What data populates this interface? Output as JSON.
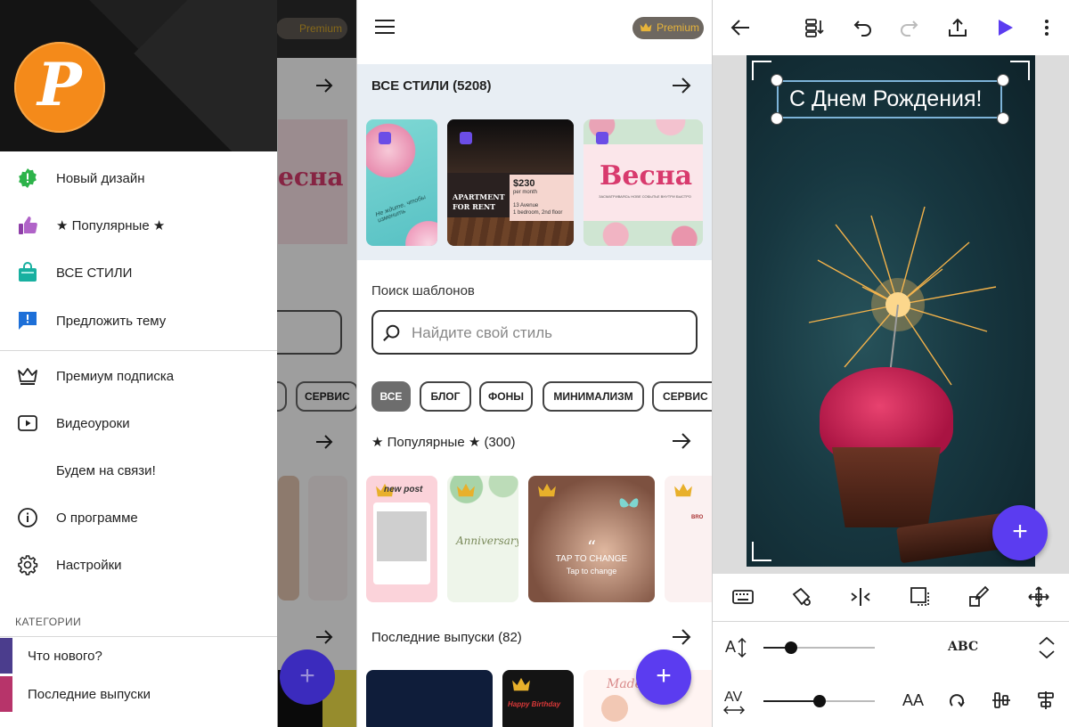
{
  "drawer": {
    "logo_letter": "P",
    "menu_items": [
      {
        "label": "Новый дизайн",
        "icon": "new-design-badge-icon"
      },
      {
        "label": "★ Популярные ★",
        "icon": "thumbs-up-icon"
      },
      {
        "label": "ВСЕ СТИЛИ",
        "icon": "shopping-bag-icon"
      },
      {
        "label": "Предложить тему",
        "icon": "feedback-icon"
      },
      {
        "label": "Премиум подписка",
        "icon": "crown-icon"
      },
      {
        "label": "Видеоуроки",
        "icon": "video-play-icon"
      },
      {
        "label": "Будем на связи!",
        "icon": ""
      },
      {
        "label": "О программе",
        "icon": "info-icon"
      },
      {
        "label": "Настройки",
        "icon": "gear-icon"
      }
    ],
    "categories_header": "КАТЕГОРИИ",
    "categories": [
      {
        "label": "Что нового?"
      },
      {
        "label": "Последние выпуски"
      }
    ]
  },
  "background_screen": {
    "premium_label": "Premium",
    "card_word": "есна",
    "chip_label": "СЕРВИС"
  },
  "main": {
    "premium_label": "Premium",
    "all_styles_title": "ВСЕ СТИЛИ (5208)",
    "template_cards": [
      {
        "text": "Не ждите, чтобы изменить"
      },
      {
        "title": "APARTMENT FOR RENT",
        "price": "$230",
        "period": "per month",
        "address": "13 Avenue",
        "rooms": "1 bedroom, 2nd floor"
      },
      {
        "title": "Весна",
        "subtitle": "ЗАСМАТРИВАЯСЬ НОВЕ СОБЫТЬЕ ВНУТРИ БЫСТРО"
      }
    ],
    "search_label": "Поиск шаблонов",
    "search_placeholder": "Найдите свой стиль",
    "chips": [
      "ВСЕ",
      "БЛОГ",
      "ФОНЫ",
      "МИНИМАЛИЗМ",
      "СЕРВИС"
    ],
    "popular_title": "★ Популярные ★ (300)",
    "popular_cards": [
      {
        "text": "new post"
      },
      {
        "text": "Anniversary"
      },
      {
        "title": "TAP TO CHANGE",
        "subtitle": "Tap to change"
      },
      {
        "text": "BRO"
      }
    ],
    "latest_title": "Последние выпуски (82)",
    "latest_cards": [
      {
        "text": ""
      },
      {
        "text": "Happy Birthday"
      },
      {
        "text": "Madeline"
      }
    ],
    "fab_label": "+"
  },
  "editor": {
    "canvas_text": "С Днем Рождения!",
    "font_style_label": "ABC",
    "case_label": "AA",
    "line_height_label": "A",
    "letter_spacing_label": "AV",
    "line_height_value": 0.25,
    "letter_spacing_value": 0.5,
    "fab_label": "+",
    "colors": {
      "accent": "#5b3cf0",
      "selection": "#7db3d8"
    }
  }
}
